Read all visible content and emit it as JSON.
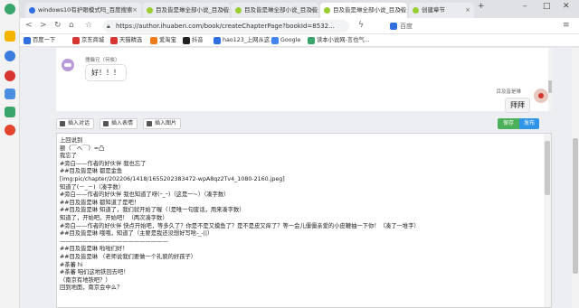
{
  "browser": {
    "tabs": [
      {
        "title": "windows10有护眼模式吗_百度搜索",
        "active": false,
        "fav_color": "#2f6fe0"
      },
      {
        "title": "目及皆是琳全部小说_目及皆是琳",
        "active": false,
        "fav_color": "#9acd32"
      },
      {
        "title": "目及皆是琳全部小说_目及皆是琳",
        "active": false,
        "fav_color": "#9acd32"
      },
      {
        "title": "目及皆是琳全部小说_目及皆是琳",
        "active": true,
        "fav_color": "#9acd32"
      },
      {
        "title": "创建章节",
        "active": false,
        "fav_color": "#9acd32"
      }
    ],
    "address": "https://author.ihuaben.com/book/createChapterPage?bookId=8532...",
    "search_engine": "百度",
    "bookmarks": [
      {
        "label": "百度一下",
        "color": "#2f6fe0"
      },
      {
        "label": "京东商城",
        "color": "#d6362f"
      },
      {
        "label": "天猫精选",
        "color": "#d6362f"
      },
      {
        "label": "爱淘宝",
        "color": "#f07b1d"
      },
      {
        "label": "抖音",
        "color": "#222222"
      },
      {
        "label": "hao123_上网从这...",
        "color": "#2f6fe0"
      },
      {
        "label": "Google",
        "color": "#4285f4"
      },
      {
        "label": "读本小说网-言也气...",
        "color": "#3aa56b"
      }
    ]
  },
  "chat": {
    "left_name": "傀儡兄（何俊）",
    "left_message": "好！！！",
    "right_name": "目及皆是琳",
    "right_message": "拜拜"
  },
  "toolbar": {
    "insert_dialog": "插入对话",
    "insert_emoji": "插入表情",
    "insert_image": "插入图片",
    "save": "保存",
    "publish": "发布"
  },
  "editor": {
    "lines": [
      "   上回说到",
      "   额（￣へ￣）=凸",
      "   我忘了",
      "#旁白——作者的好伙伴 我也忘了",
      "##目及皆是琳 都是金鱼",
      "[img:pic/chapter/202206/1418/1655202383472-wpA8qz2Tv4_1080-2160.jpeg]",
      "   知道了(－_－)（凑字数）",
      "#旁白——作者的好伙伴 我也知道了呀(ｰ_ｰ)（这是一~）（凑字数）",
      "##目及皆是琳 都知道了是吧！",
      "##目及皆是琳 知道了，我们就开始了喔（（是唯一句废话，用来凑字数）",
      "   知道了，开始吧。开始吧！（两次凑字数）",
      "#旁白——作者的好伙伴 快点开始吧，等多久了？你是不是又摸鱼了？是不是皮又痒了？等一会儿僵僵亲爱的小皮鞭抽一下你！（凑了一堆字）",
      "##目及皆是琳 哦哦，知道了（主要是我还没想好写啥-_-||）",
      "———————————————————",
      "##目及皆是琳 啦啦们好！",
      "##目及皆是琳 （老师说我们要做一个礼貌的好孩子）",
      "#茶蕃 hi",
      "#茶蕃 咱们这地铁回去吧！",
      "   （南京有地铁吧？）",
      "   回到地面，南京会中么？"
    ]
  }
}
